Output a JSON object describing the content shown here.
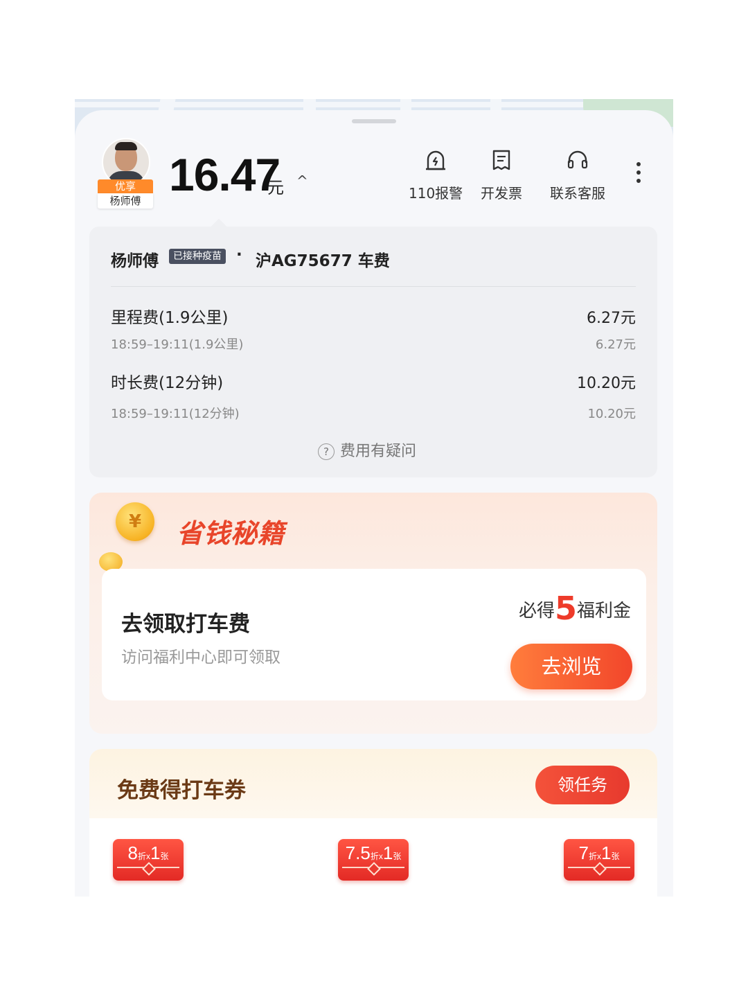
{
  "header": {
    "driver_tag": "优享",
    "driver_name": "杨师傅",
    "total_price": "16.47",
    "price_unit": "元",
    "expand_glyph": "^",
    "actions": [
      {
        "label": "110报警",
        "icon": "alarm-icon"
      },
      {
        "label": "开发票",
        "icon": "invoice-icon"
      },
      {
        "label": "联系客服",
        "icon": "headset-icon"
      }
    ],
    "more_icon": "more-vertical-icon"
  },
  "fee": {
    "driver": "杨师傅",
    "vaccine_badge": "已接种疫苗",
    "separator": "·",
    "plate_and_title": "沪AG75677 车费",
    "items": [
      {
        "title": "里程费(1.9公里)",
        "amount": "6.27元",
        "detail": "18:59–19:11(1.9公里)",
        "detail_amount": "6.27元"
      },
      {
        "title": "时长费(12分钟)",
        "amount": "10.20元",
        "detail": "18:59–19:11(12分钟)",
        "detail_amount": "10.20元"
      }
    ],
    "question": "费用有疑问"
  },
  "promo": {
    "title": "省钱秘籍",
    "task_title": "去领取打车费",
    "task_desc": "访问福利中心即可领取",
    "reward_prefix": "必得",
    "reward_value": "5",
    "reward_suffix": "福利金",
    "button": "去浏览"
  },
  "coupons": {
    "title": "免费得打车券",
    "button": "领任务",
    "items": [
      {
        "discount": "8",
        "unit": "折",
        "times": "x",
        "count": "1",
        "count_unit": "张"
      },
      {
        "discount": "7.5",
        "unit": "折",
        "times": "x",
        "count": "1",
        "count_unit": "张"
      },
      {
        "discount": "7",
        "unit": "折",
        "times": "x",
        "count": "1",
        "count_unit": "张"
      }
    ]
  },
  "colors": {
    "accent": "#f2462b",
    "badge": "#ff8a2a"
  }
}
